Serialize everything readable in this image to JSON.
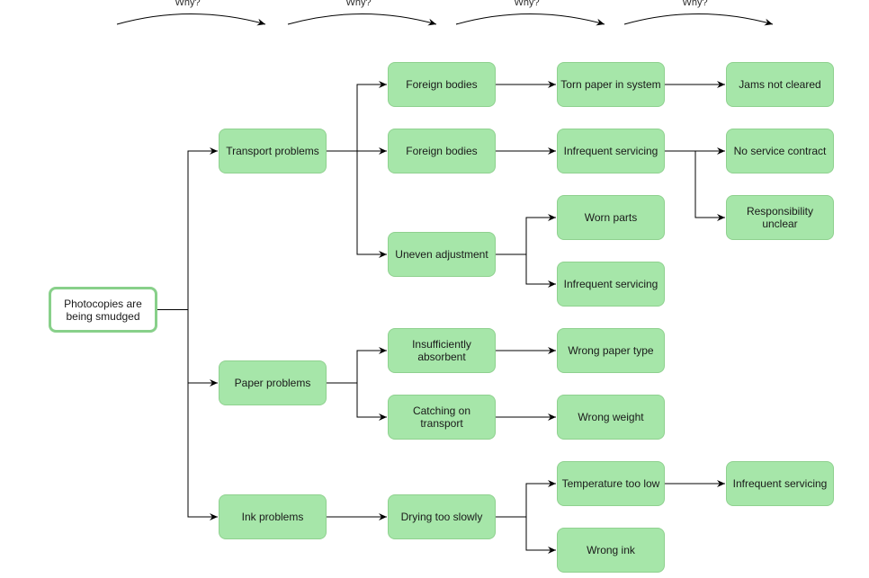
{
  "diagram": {
    "type": "five-whys",
    "why_label": "Why?",
    "why_arrows": 4,
    "colors": {
      "node_fill": "#a6e6a9",
      "node_border": "#8fd18f",
      "root_border": "#88d08a",
      "edge": "#000000"
    },
    "root": {
      "id": "root",
      "label": "Photocopies are being smudged"
    },
    "nodes": [
      {
        "id": "transport",
        "label": "Transport problems",
        "parent": "root"
      },
      {
        "id": "paper",
        "label": "Paper problems",
        "parent": "root"
      },
      {
        "id": "ink",
        "label": "Ink problems",
        "parent": "root"
      },
      {
        "id": "foreign1",
        "label": "Foreign bodies",
        "parent": "transport"
      },
      {
        "id": "foreign2",
        "label": "Foreign bodies",
        "parent": "transport"
      },
      {
        "id": "uneven",
        "label": "Uneven adjustment",
        "parent": "transport"
      },
      {
        "id": "torn",
        "label": "Torn paper in system",
        "parent": "foreign1"
      },
      {
        "id": "infreq1",
        "label": "Infrequent servicing",
        "parent": "foreign2"
      },
      {
        "id": "worn",
        "label": "Worn parts",
        "parent": "uneven"
      },
      {
        "id": "infreq2",
        "label": "Infrequent servicing",
        "parent": "uneven"
      },
      {
        "id": "jams",
        "label": "Jams not cleared",
        "parent": "torn"
      },
      {
        "id": "nocontract",
        "label": "No service contract",
        "parent": "infreq1"
      },
      {
        "id": "resp",
        "label": "Responsibility unclear",
        "parent": "infreq1"
      },
      {
        "id": "insuff",
        "label": "Insufficiently absorbent",
        "parent": "paper"
      },
      {
        "id": "catching",
        "label": "Catching on transport",
        "parent": "paper"
      },
      {
        "id": "wrongtype",
        "label": "Wrong paper type",
        "parent": "insuff"
      },
      {
        "id": "wrongweight",
        "label": "Wrong weight",
        "parent": "catching"
      },
      {
        "id": "drying",
        "label": "Drying too slowly",
        "parent": "ink"
      },
      {
        "id": "temp",
        "label": "Temperature too low",
        "parent": "drying"
      },
      {
        "id": "wrongink",
        "label": "Wrong ink",
        "parent": "drying"
      },
      {
        "id": "infreq3",
        "label": "Infrequent servicing",
        "parent": "temp"
      }
    ]
  }
}
